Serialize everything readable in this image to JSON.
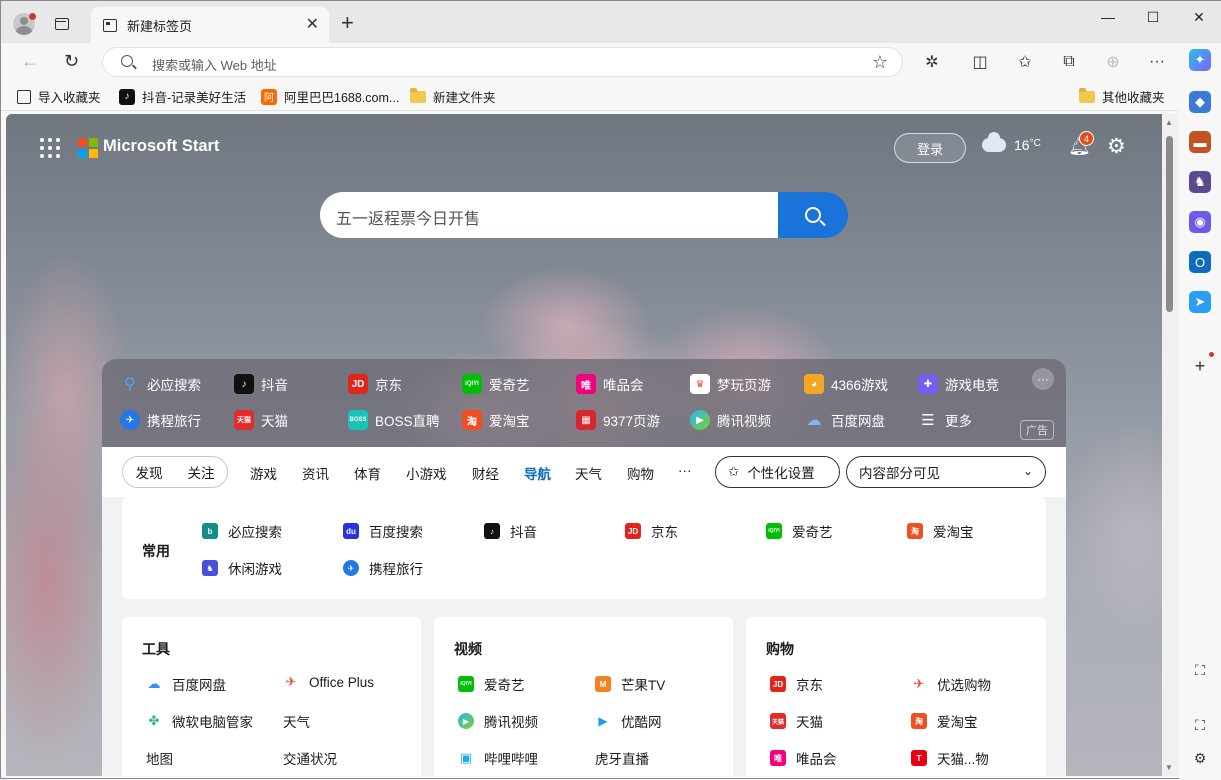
{
  "browser": {
    "tab_title": "新建标签页",
    "new_tab": "+",
    "address_placeholder": "搜索或输入 Web 地址",
    "window_controls": {
      "minimize": "—",
      "maximize": "☐",
      "close": "✕"
    }
  },
  "bookmarks": [
    {
      "label": "导入收藏夹",
      "icon": "import-icon"
    },
    {
      "label": "抖音-记录美好生活",
      "icon": "douyin-icon"
    },
    {
      "label": "阿里巴巴1688.com...",
      "icon": "alibaba-icon"
    },
    {
      "label": "新建文件夹",
      "icon": "folder-icon"
    }
  ],
  "other_bookmarks": "其他收藏夹",
  "start": {
    "brand": "Microsoft Start",
    "login": "登录",
    "temperature": "16",
    "temp_unit": "°C",
    "notifications": "4",
    "search_query": "五一返程票今日开售"
  },
  "quick_links": [
    {
      "label": "必应搜索",
      "icon": "bing-search-icon",
      "color": "#3a7bd5"
    },
    {
      "label": "抖音",
      "icon": "douyin-icon",
      "color": "#111111"
    },
    {
      "label": "京东",
      "icon": "jd-icon",
      "color": "#e1251b"
    },
    {
      "label": "爱奇艺",
      "icon": "iqiyi-icon",
      "color": "#00be06"
    },
    {
      "label": "唯品会",
      "icon": "vip-icon",
      "color": "#f10180"
    },
    {
      "label": "梦玩页游",
      "icon": "mengwan-icon",
      "color": "#e84a4a"
    },
    {
      "label": "4366游戏",
      "icon": "4366-icon",
      "color": "#f5a623"
    },
    {
      "label": "游戏电竞",
      "icon": "gamepad-icon",
      "color": "#7b5cf0"
    },
    {
      "label": "携程旅行",
      "icon": "ctrip-icon",
      "color": "#2577e3"
    },
    {
      "label": "天猫",
      "icon": "tmall-icon",
      "color": "#e22c2c"
    },
    {
      "label": "BOSS直聘",
      "icon": "boss-icon",
      "color": "#19c4b6"
    },
    {
      "label": "爱淘宝",
      "icon": "taobao-icon",
      "color": "#f04e23"
    },
    {
      "label": "9377页游",
      "icon": "9377-icon",
      "color": "#d9252e"
    },
    {
      "label": "腾讯视频",
      "icon": "tencent-video-icon",
      "color": "#21b5ff"
    },
    {
      "label": "百度网盘",
      "icon": "baidu-pan-icon",
      "color": "#3b8cff"
    },
    {
      "label": "更多",
      "icon": "menu-icon",
      "color": "#ffffff"
    }
  ],
  "ad_label": "广告",
  "feed": {
    "toggle": [
      "发现",
      "关注"
    ],
    "tabs": [
      "游戏",
      "资讯",
      "体育",
      "小游戏",
      "财经",
      "导航",
      "天气",
      "购物",
      "···"
    ],
    "active_tab": "导航",
    "personalize": "个性化设置",
    "visibility": "内容部分可见"
  },
  "common": {
    "title": "常用",
    "links": [
      {
        "label": "必应搜索",
        "icon": "bing-icon",
        "color": "#138f8a"
      },
      {
        "label": "百度搜索",
        "icon": "baidu-icon",
        "color": "#2932e1"
      },
      {
        "label": "抖音",
        "icon": "douyin-icon",
        "color": "#111111"
      },
      {
        "label": "京东",
        "icon": "jd-icon",
        "color": "#e1251b"
      },
      {
        "label": "爱奇艺",
        "icon": "iqiyi-icon",
        "color": "#00be06"
      },
      {
        "label": "爱淘宝",
        "icon": "taobao-icon",
        "color": "#f04e23"
      },
      {
        "label": "休闲游戏",
        "icon": "chess-icon",
        "color": "#4b4ed8"
      },
      {
        "label": "携程旅行",
        "icon": "ctrip-icon",
        "color": "#2577e3"
      }
    ]
  },
  "categories": [
    {
      "title": "工具",
      "links": [
        {
          "label": "百度网盘",
          "icon": "baidu-pan-icon",
          "color": "#3b8cff"
        },
        {
          "label": "Office Plus",
          "icon": "office-plus-icon",
          "color": "#e8542e"
        },
        {
          "label": "微软电脑管家",
          "icon": "pc-manager-icon",
          "color": "#2fbf71"
        },
        {
          "label": "天气",
          "icon": "",
          "color": ""
        },
        {
          "label": "地图",
          "icon": "",
          "color": ""
        },
        {
          "label": "交通状况",
          "icon": "",
          "color": ""
        }
      ]
    },
    {
      "title": "视频",
      "links": [
        {
          "label": "爱奇艺",
          "icon": "iqiyi-icon",
          "color": "#00be06"
        },
        {
          "label": "芒果TV",
          "icon": "mango-icon",
          "color": "#f58220"
        },
        {
          "label": "腾讯视频",
          "icon": "tencent-video-icon",
          "color": "#21b5ff"
        },
        {
          "label": "优酷网",
          "icon": "youku-icon",
          "color": "#1f9cf0"
        },
        {
          "label": "哔哩哔哩",
          "icon": "bilibili-icon",
          "color": "#23ade5"
        },
        {
          "label": "虎牙直播",
          "icon": "",
          "color": ""
        }
      ]
    },
    {
      "title": "购物",
      "links": [
        {
          "label": "京东",
          "icon": "jd-icon",
          "color": "#e1251b"
        },
        {
          "label": "优选购物",
          "icon": "youxuan-icon",
          "color": "#e84a3c"
        },
        {
          "label": "天猫",
          "icon": "tmall-icon",
          "color": "#e22c2c"
        },
        {
          "label": "爱淘宝",
          "icon": "taobao-icon",
          "color": "#f04e23"
        },
        {
          "label": "唯品会",
          "icon": "vip-icon",
          "color": "#f10180"
        },
        {
          "label": "天猫...物",
          "icon": "tmall-mart-icon",
          "color": "#e60012"
        }
      ]
    }
  ]
}
